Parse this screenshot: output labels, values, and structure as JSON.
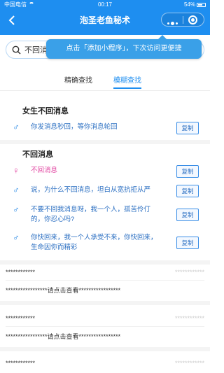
{
  "status_bar": {
    "carrier": "中国电信",
    "time": "00:17",
    "battery": "54%"
  },
  "header": {
    "title": "泡圣老鱼秘术"
  },
  "search": {
    "value": "不回消"
  },
  "tooltip": {
    "text": "点击「添加小程序」，下次访问更便捷"
  },
  "tabs": [
    {
      "label": "精确查找"
    },
    {
      "label": "模糊查找",
      "active": true
    }
  ],
  "sections": [
    {
      "title": "女生不回消息",
      "items": [
        {
          "gender": "♂",
          "text": "你发消息秒回，等你消息轮回",
          "copy": "复制"
        }
      ]
    },
    {
      "title": "不回消息",
      "items": [
        {
          "gender": "♀",
          "text": "不回消息",
          "copy": "复制"
        },
        {
          "gender": "♂",
          "text": "说，为什么不回消息，坦白从宽抗拒从严",
          "copy": "复制"
        },
        {
          "gender": "♂",
          "text": "不要不回我消息呀，我一个人，孤苦伶仃的，你忍心吗?",
          "copy": "复制"
        },
        {
          "gender": "♂",
          "text": "你快回来，我一个人承受不来，你快回来，生命因你而精彩",
          "copy": "复制"
        }
      ]
    }
  ],
  "masked": [
    {
      "left": "************",
      "right": "************",
      "center": "*****************请点击查看*****************"
    },
    {
      "left": "************",
      "right": "************",
      "center": "*****************请点击查看*****************"
    },
    {
      "left": "************",
      "right": "************"
    }
  ],
  "colors": {
    "header": "#1e8ef0",
    "accent": "#2b6fc2",
    "male": "#2b8ae6",
    "female": "#e0409f"
  }
}
